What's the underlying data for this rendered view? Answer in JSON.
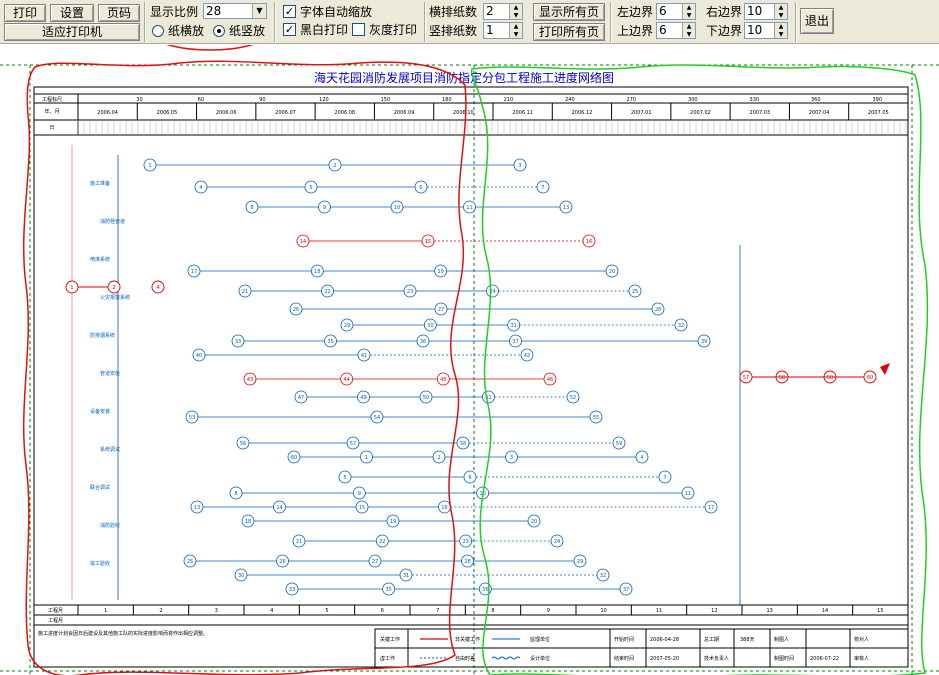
{
  "toolbar": {
    "print_label": "打印",
    "settings_label": "设置",
    "margins_label": "页码",
    "fit_printer_label": "适应打印机",
    "scale_label": "显示比例",
    "scale_value": "28",
    "landscape_label": "纸横放",
    "portrait_label": "纸竖放",
    "orientation_selected": "portrait",
    "auto_font_label": "字体自动缩放",
    "auto_font_checked": true,
    "bw_print_label": "黑白打印",
    "bw_print_checked": true,
    "grayscale_label": "灰度打印",
    "grayscale_checked": false,
    "h_pages_label": "横排纸数",
    "h_pages_value": "2",
    "v_pages_label": "竖排纸数",
    "v_pages_value": "1",
    "show_all_label": "显示所有页",
    "print_all_label": "打印所有页",
    "left_margin_label": "左边界",
    "left_margin_value": "6",
    "right_margin_label": "右边界",
    "right_margin_value": "10",
    "top_margin_label": "上边界",
    "top_margin_value": "6",
    "bottom_margin_label": "下边界",
    "bottom_margin_value": "10",
    "exit_label": "退出"
  },
  "chart": {
    "title": "海天花园消防发展项目消防指定分包工程施工进度网络图",
    "row_labels": [
      "工程标尺",
      "年、月",
      "日"
    ],
    "bottom_row_label": "工程月",
    "scale_ticks": [
      "30",
      "60",
      "90",
      "120",
      "150",
      "180",
      "210",
      "240",
      "270",
      "300",
      "330",
      "360",
      "390"
    ],
    "months": [
      "2006.04",
      "2006.05",
      "2006.06",
      "2006.07",
      "2006.08",
      "2006.09",
      "2006.10",
      "2006.11",
      "2006.12",
      "2007.01",
      "2007.02",
      "2007.03",
      "2007.04",
      "2007.05"
    ],
    "bottom_months": [
      "1",
      "2",
      "3",
      "4",
      "5",
      "6",
      "7",
      "8",
      "9",
      "10",
      "11",
      "12",
      "13",
      "14",
      "15"
    ],
    "footnote": "施工进度计划会因日后建设及其他施工队的实际进度影响而将作出相应调整。",
    "legend": {
      "critical": "关键工作",
      "normal": "非关键工作",
      "virtual": "虚工作",
      "free_float": "自由时差",
      "owner": "监理单位",
      "designer": "设计单位",
      "start_time_label": "开始时间",
      "start_time": "2006-04-28",
      "total_duration_label": "总工期",
      "total_duration": "388天",
      "preparer_label": "制图人",
      "end_time_label": "结束时间",
      "end_time": "2007-05-20",
      "tech_label": "技术负责人",
      "date_label": "制图时间",
      "draw_date": "2006-07-22",
      "checker_label": "校对人",
      "reviewer_label": "审核人"
    },
    "nodes": [
      "1",
      "2",
      "3",
      "4",
      "5",
      "6",
      "7",
      "8",
      "9",
      "10",
      "11",
      "13",
      "14",
      "15",
      "16",
      "17",
      "18",
      "19",
      "20",
      "21",
      "22",
      "23",
      "24",
      "25",
      "26",
      "27",
      "28",
      "29",
      "30",
      "31",
      "32",
      "33",
      "35",
      "36",
      "37",
      "39",
      "40",
      "41",
      "42",
      "43",
      "44",
      "45",
      "46",
      "47",
      "49",
      "50",
      "51",
      "52",
      "53",
      "54",
      "55",
      "56",
      "57",
      "58",
      "59",
      "60"
    ],
    "activity_labels": [
      "施工准备",
      "消防栓管道",
      "喷淋系统",
      "火灾报警系统",
      "防排烟系统",
      "管道安装",
      "设备安装",
      "系统调试",
      "联合调试",
      "消防验收",
      "竣工验收"
    ]
  }
}
